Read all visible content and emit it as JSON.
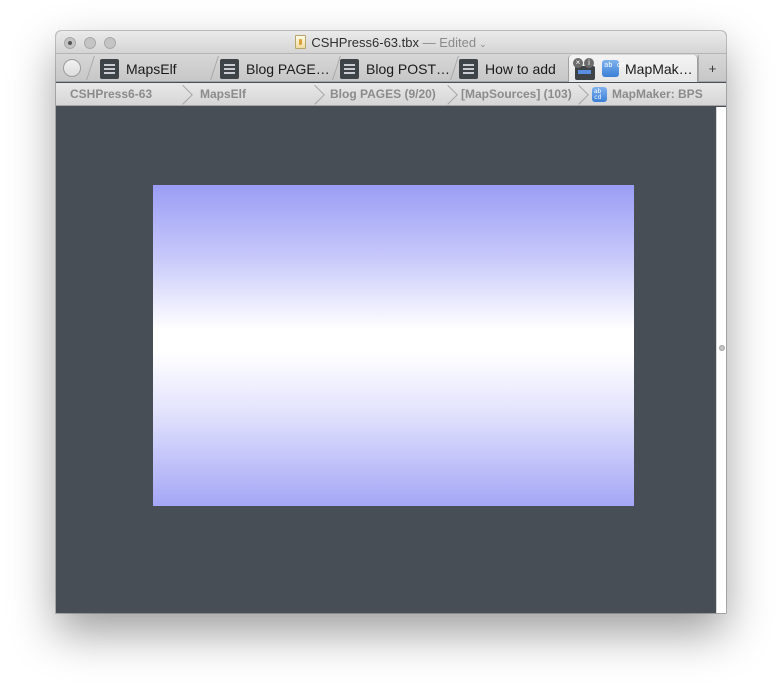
{
  "window": {
    "title": "CSHPress6-63.tbx",
    "title_separator": "—",
    "status": "Edited",
    "status_chevron": "⌄"
  },
  "tabs": [
    {
      "label": "MapsElf",
      "icon": "note-icon"
    },
    {
      "label": "Blog PAGE…",
      "icon": "note-icon"
    },
    {
      "label": "Blog POST…",
      "icon": "note-icon"
    },
    {
      "label": "How to add",
      "icon": "note-icon"
    },
    {
      "label": "MapMak…",
      "icon": "abc-icon",
      "active": true
    }
  ],
  "tab_add_label": "+",
  "breadcrumbs": [
    {
      "label": "CSHPress6-63"
    },
    {
      "label": "MapsElf"
    },
    {
      "label": "Blog PAGES (9/20)"
    },
    {
      "label": "[MapSources] (103)"
    },
    {
      "label": "MapMaker: BPS"
    }
  ],
  "icon_glyphs": {
    "abc": "ab cd",
    "close_badge": "×",
    "info_badge": "i"
  },
  "colors": {
    "canvas_background": "#484e55",
    "gradient_top": "#9b9df5",
    "gradient_middle": "#ffffff",
    "gradient_bottom": "#a4a6f6"
  }
}
